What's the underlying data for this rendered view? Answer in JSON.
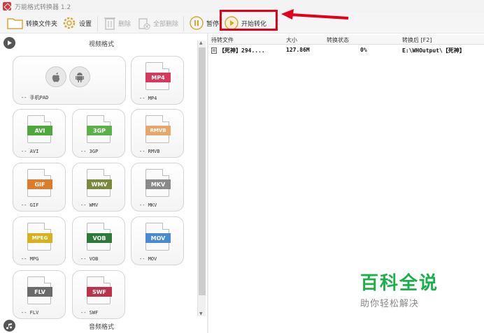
{
  "window": {
    "title": "万能格式转换器 1.2"
  },
  "toolbar": {
    "convert_folder": "转换文件夹",
    "settings": "设置",
    "delete": "删除",
    "delete_all": "全部删除",
    "pause": "暂停",
    "start": "开始转化"
  },
  "video_section": {
    "label": "视频格式"
  },
  "audio_section": {
    "label": "音频格式"
  },
  "formats": [
    {
      "tag": "",
      "name": "-- 手机PAD",
      "color": "#888888"
    },
    {
      "tag": "MP4",
      "name": "-- MP4",
      "color": "#d6395c"
    },
    {
      "tag": "AVI",
      "name": "-- AVI",
      "color": "#4fa83d"
    },
    {
      "tag": "3GP",
      "name": "-- 3GP",
      "color": "#5bb04a"
    },
    {
      "tag": "RMVB",
      "name": "-- RMVB",
      "color": "#e8a76a"
    },
    {
      "tag": "GIF",
      "name": "-- GIF",
      "color": "#e07b2a"
    },
    {
      "tag": "WMV",
      "name": "-- WMV",
      "color": "#7a8a3a"
    },
    {
      "tag": "MKV",
      "name": "-- MKV",
      "color": "#8a8a8a"
    },
    {
      "tag": "MPEG",
      "name": "-- MPG",
      "color": "#d8b21e"
    },
    {
      "tag": "VOB",
      "name": "-- VOB",
      "color": "#2f7a3a"
    },
    {
      "tag": "MOV",
      "name": "-- MOV",
      "color": "#4a8ad0"
    },
    {
      "tag": "FLV",
      "name": "-- FLV",
      "color": "#6a6a6a"
    },
    {
      "tag": "SWF",
      "name": "-- SWF",
      "color": "#c0304a"
    }
  ],
  "table": {
    "headers": [
      "待转文件",
      "大小",
      "转换状态",
      "转换后 [F2]"
    ],
    "rows": [
      {
        "file": "【死神】294....",
        "size": "127.86M",
        "status": "0%",
        "output": "E:\\WHOutput\\【死神】"
      }
    ]
  },
  "watermark": {
    "line1": "百科全说",
    "line2": "助你轻松解决"
  }
}
